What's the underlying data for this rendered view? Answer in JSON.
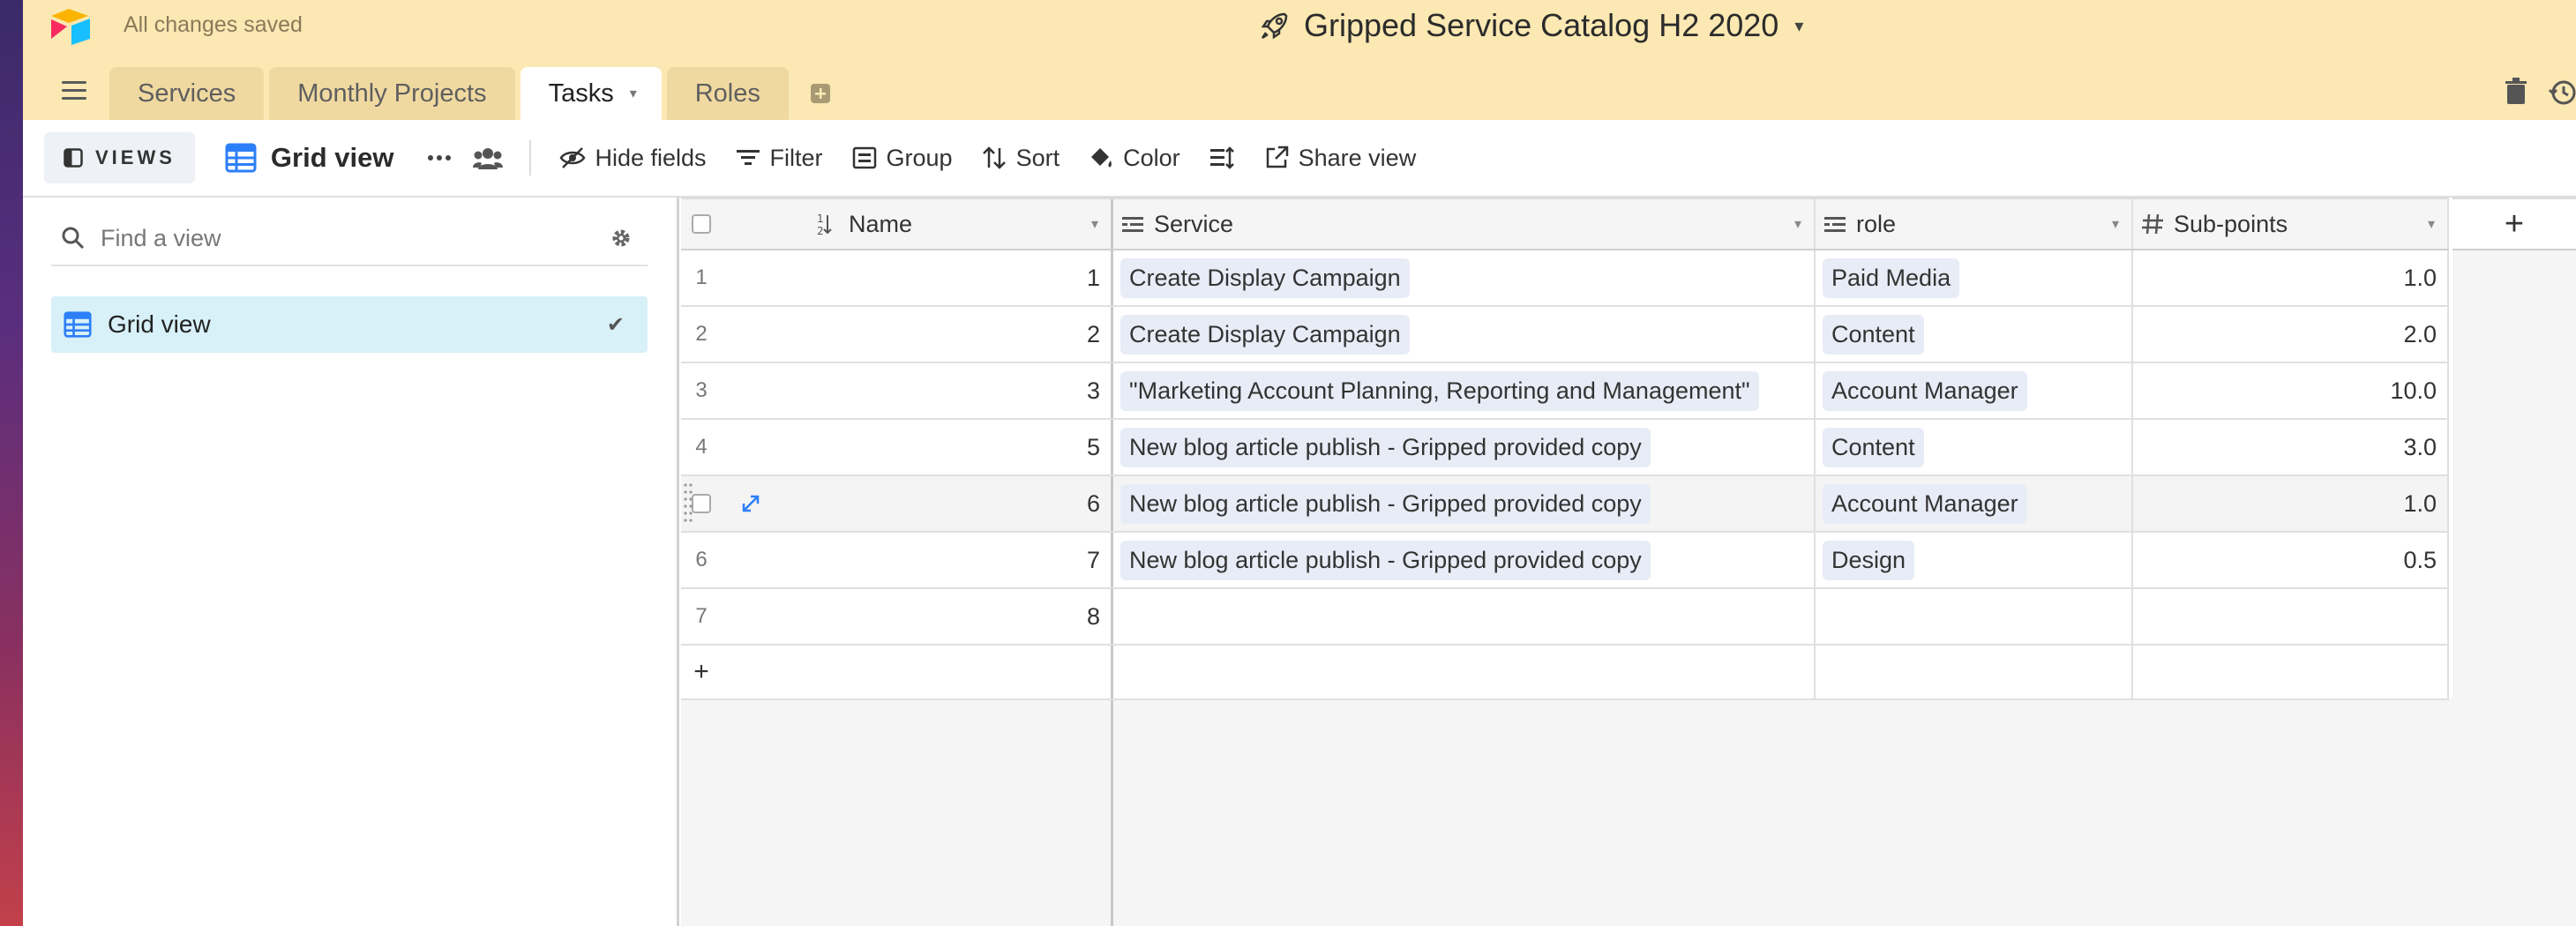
{
  "header": {
    "status": "All changes saved",
    "title": "Gripped Service Catalog H2 2020",
    "caret": "▾"
  },
  "tabs": [
    {
      "label": "Services"
    },
    {
      "label": "Monthly Projects"
    },
    {
      "label": "Tasks",
      "active": true,
      "caret": "▾"
    },
    {
      "label": "Roles"
    }
  ],
  "toolbar": {
    "views_label": "VIEWS",
    "view_name": "Grid view",
    "hide_fields": "Hide fields",
    "filter": "Filter",
    "group": "Group",
    "sort": "Sort",
    "color": "Color",
    "share_view": "Share view"
  },
  "sidebar": {
    "search_placeholder": "Find a view",
    "views": [
      {
        "label": "Grid view",
        "check": "✔"
      }
    ]
  },
  "grid": {
    "columns": {
      "name": "Name",
      "service": "Service",
      "role": "role",
      "subpoints": "Sub-points",
      "header_caret": "▾",
      "add_column": "+"
    },
    "rows": [
      {
        "index": "1",
        "name": "1",
        "service": "Create Display Campaign",
        "role": "Paid Media",
        "subpoints": "1.0"
      },
      {
        "index": "2",
        "name": "2",
        "service": "Create Display Campaign",
        "role": "Content",
        "subpoints": "2.0"
      },
      {
        "index": "3",
        "name": "3",
        "service": "\"Marketing Account Planning, Reporting and Management\"",
        "role": "Account Manager",
        "subpoints": "10.0"
      },
      {
        "index": "4",
        "name": "5",
        "service": "New blog article publish - Gripped provided copy",
        "role": "Content",
        "subpoints": "3.0"
      },
      {
        "index": "",
        "name": "6",
        "service": "New blog article publish - Gripped provided copy",
        "role": "Account Manager",
        "subpoints": "1.0",
        "hovered": true
      },
      {
        "index": "6",
        "name": "7",
        "service": "New blog article publish - Gripped provided copy",
        "role": "Design",
        "subpoints": "0.5"
      },
      {
        "index": "7",
        "name": "8",
        "service": "",
        "role": "",
        "subpoints": ""
      }
    ],
    "add_row": "+"
  },
  "colors": {
    "header_bg": "#fbe8b2",
    "tab_bg": "#f0d9a0",
    "accent_blue": "#2d7ff9",
    "selected_view_bg": "#d8f0f8",
    "pill_bg": "#e8ecf6"
  },
  "icons": [
    "airtable-logo-icon",
    "rocket-icon",
    "hamburger-icon",
    "add-table-icon",
    "trash-icon",
    "history-icon",
    "panel-icon",
    "grid-icon",
    "more-icon",
    "collaborators-icon",
    "hide-fields-icon",
    "filter-icon",
    "group-icon",
    "sort-icon",
    "color-icon",
    "row-height-icon",
    "share-icon",
    "search-icon",
    "gear-icon",
    "check-icon",
    "number-field-icon",
    "link-field-icon",
    "lookup-field-icon",
    "expand-icon"
  ]
}
